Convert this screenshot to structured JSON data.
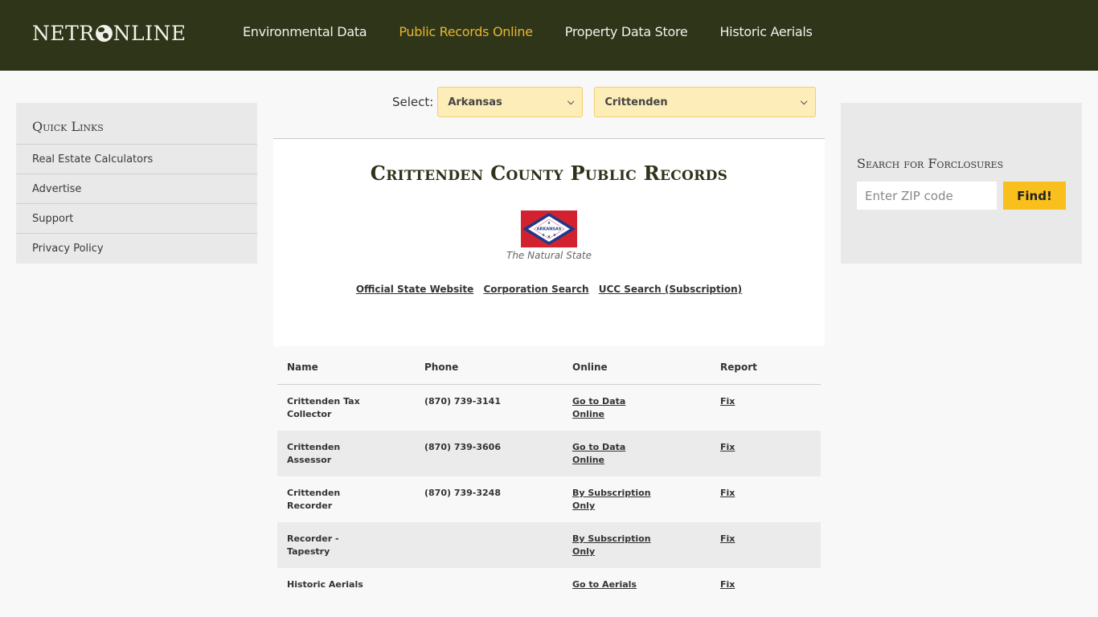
{
  "header": {
    "logo": {
      "pre": "NETR",
      "post": "NLINE"
    },
    "nav": [
      {
        "label": "Environmental Data",
        "active": false
      },
      {
        "label": "Public Records Online",
        "active": true
      },
      {
        "label": "Property Data Store",
        "active": false
      },
      {
        "label": "Historic Aerials",
        "active": false
      }
    ]
  },
  "quick_links": {
    "title": "Quick Links",
    "items": [
      "Real Estate Calculators",
      "Advertise",
      "Support",
      "Privacy Policy"
    ]
  },
  "selector": {
    "label": "Select:",
    "state_value": "Arkansas",
    "county_value": "Crittenden"
  },
  "main": {
    "title": "Crittenden County Public Records",
    "flag_text": "ARKANSAS",
    "nickname": "The Natural State",
    "links": [
      "Official State Website",
      "Corporation Search",
      "UCC Search (Subscription)"
    ]
  },
  "table": {
    "headers": [
      "Name",
      "Phone",
      "Online",
      "Report"
    ],
    "rows": [
      {
        "name": "Crittenden Tax Collector",
        "phone": "(870) 739-3141",
        "online": "Go to Data Online",
        "report": "Fix"
      },
      {
        "name": "Crittenden Assessor",
        "phone": "(870) 739-3606",
        "online": "Go to Data Online",
        "report": "Fix"
      },
      {
        "name": "Crittenden Recorder",
        "phone": "(870) 739-3248",
        "online": "By Subscription Only",
        "report": "Fix"
      },
      {
        "name": "Recorder - Tapestry",
        "phone": "",
        "online": "By Subscription Only",
        "report": "Fix"
      },
      {
        "name": "Historic Aerials",
        "phone": "",
        "online": "Go to Aerials",
        "report": "Fix"
      }
    ]
  },
  "foreclosure": {
    "title": "Search for Forclosures",
    "zip_placeholder": "Enter ZIP code",
    "zip_value": "",
    "button": "Find!"
  },
  "colors": {
    "header_bg": "#2e3519",
    "accent_gold": "#e7b52f",
    "button_gold": "#f8bf1d",
    "select_bg": "#fdedb8"
  }
}
